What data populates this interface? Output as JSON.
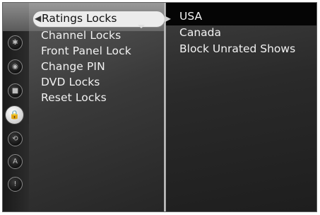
{
  "menu": {
    "items": [
      {
        "label": "Ratings Locks",
        "selected": true
      },
      {
        "label": "Channel Locks"
      },
      {
        "label": "Front Panel Lock"
      },
      {
        "label": "Change PIN"
      },
      {
        "label": "DVD Locks"
      },
      {
        "label": "Reset Locks"
      }
    ]
  },
  "options": {
    "items": [
      "USA",
      "Canada",
      "Block Unrated Shows"
    ]
  },
  "rail": {
    "icons": [
      "settings-icon",
      "audio-icon",
      "record-icon",
      "lock-icon",
      "network-icon",
      "program-icon",
      "alert-icon"
    ],
    "active": "lock-icon"
  }
}
